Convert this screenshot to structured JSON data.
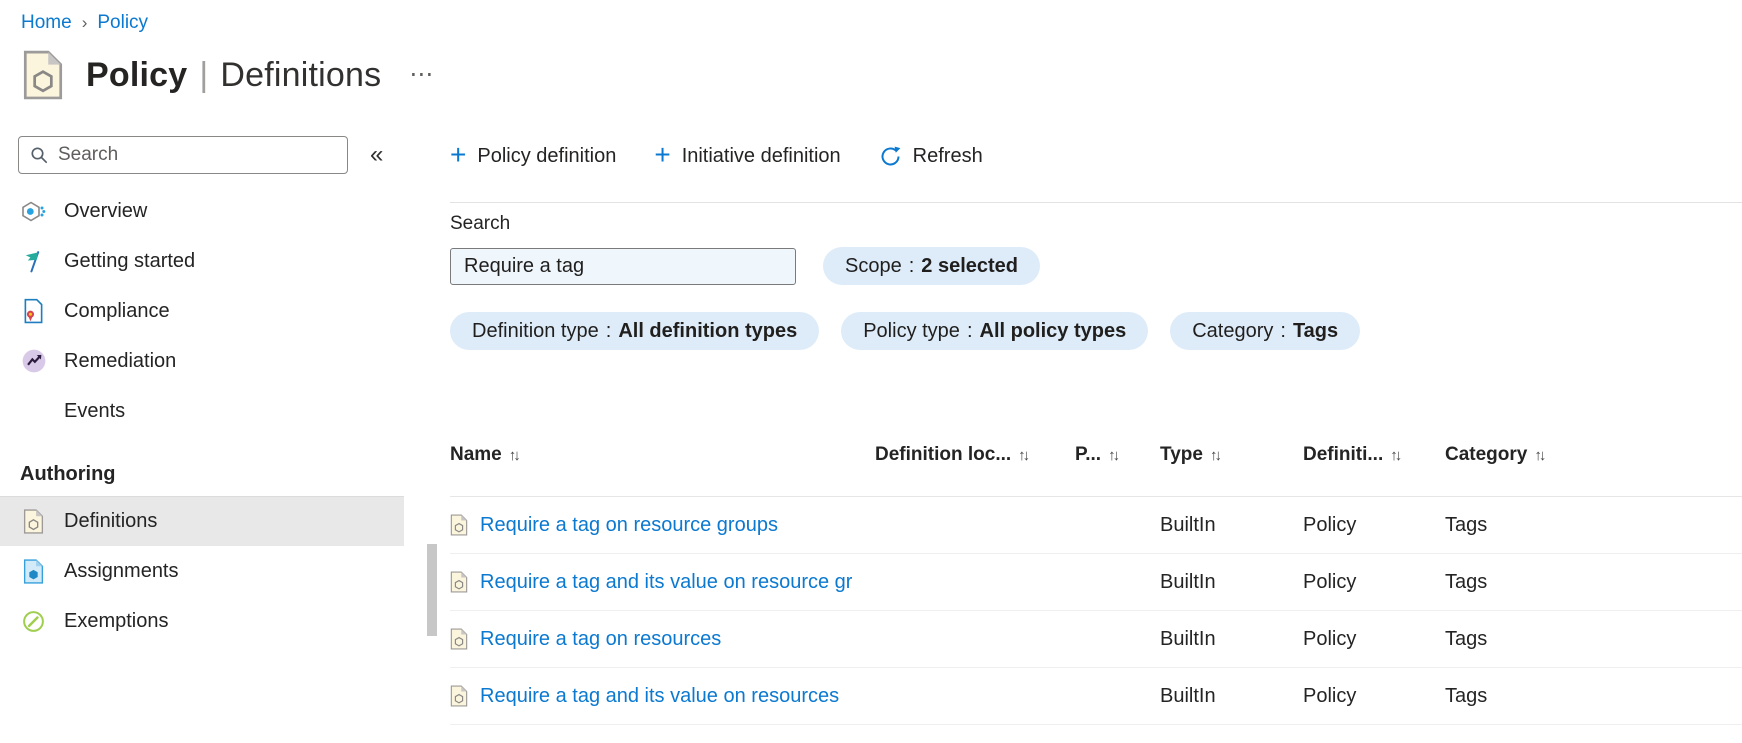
{
  "breadcrumb": {
    "items": [
      {
        "label": "Home"
      },
      {
        "label": "Policy"
      }
    ]
  },
  "header": {
    "title_primary": "Policy",
    "title_separator": "|",
    "title_secondary": "Definitions"
  },
  "icons": {
    "breadcrumb_chevron": "›",
    "ellipsis": "⋯",
    "collapse": "«",
    "plus": "+",
    "sort": "↑↓"
  },
  "sidebar": {
    "search_placeholder": "Search",
    "items": [
      {
        "label": "Overview",
        "icon": "overview-icon"
      },
      {
        "label": "Getting started",
        "icon": "getting-started-icon"
      },
      {
        "label": "Compliance",
        "icon": "compliance-icon"
      },
      {
        "label": "Remediation",
        "icon": "remediation-icon"
      },
      {
        "label": "Events",
        "icon": "events-icon"
      }
    ],
    "section_heading": "Authoring",
    "authoring_items": [
      {
        "label": "Definitions",
        "icon": "policy-definition-icon",
        "selected": true
      },
      {
        "label": "Assignments",
        "icon": "assignments-icon",
        "selected": false
      },
      {
        "label": "Exemptions",
        "icon": "exemptions-icon",
        "selected": false
      }
    ]
  },
  "toolbar": {
    "buttons": [
      {
        "label": "Policy definition",
        "icon": "plus-icon"
      },
      {
        "label": "Initiative definition",
        "icon": "plus-icon"
      },
      {
        "label": "Refresh",
        "icon": "refresh-icon"
      }
    ]
  },
  "filters": {
    "search_label": "Search",
    "search_value": "Require a tag",
    "pill_separator": ":",
    "scope_pill": {
      "label": "Scope",
      "value": "2 selected"
    },
    "pills": [
      {
        "label": "Definition type",
        "value": "All definition types"
      },
      {
        "label": "Policy type",
        "value": "All policy types"
      },
      {
        "label": "Category",
        "value": "Tags"
      }
    ]
  },
  "table": {
    "columns": [
      {
        "label": "Name"
      },
      {
        "label": "Definition loc..."
      },
      {
        "label": "P..."
      },
      {
        "label": "Type"
      },
      {
        "label": "Definiti..."
      },
      {
        "label": "Category"
      }
    ],
    "rows": [
      {
        "name": "Require a tag on resource groups",
        "definition_location": "",
        "policies": "",
        "type": "BuiltIn",
        "definition_type": "Policy",
        "category": "Tags"
      },
      {
        "name": "Require a tag and its value on resource gr",
        "definition_location": "",
        "policies": "",
        "type": "BuiltIn",
        "definition_type": "Policy",
        "category": "Tags"
      },
      {
        "name": "Require a tag on resources",
        "definition_location": "",
        "policies": "",
        "type": "BuiltIn",
        "definition_type": "Policy",
        "category": "Tags"
      },
      {
        "name": "Require a tag and its value on resources",
        "definition_location": "",
        "policies": "",
        "type": "BuiltIn",
        "definition_type": "Policy",
        "category": "Tags"
      }
    ]
  },
  "colors": {
    "link_blue": "#0b79d0",
    "pill_background": "#deecf9",
    "search_input_background": "#eff6fc",
    "selected_item_background": "#e8e8e8",
    "text_dark": "#242424"
  }
}
